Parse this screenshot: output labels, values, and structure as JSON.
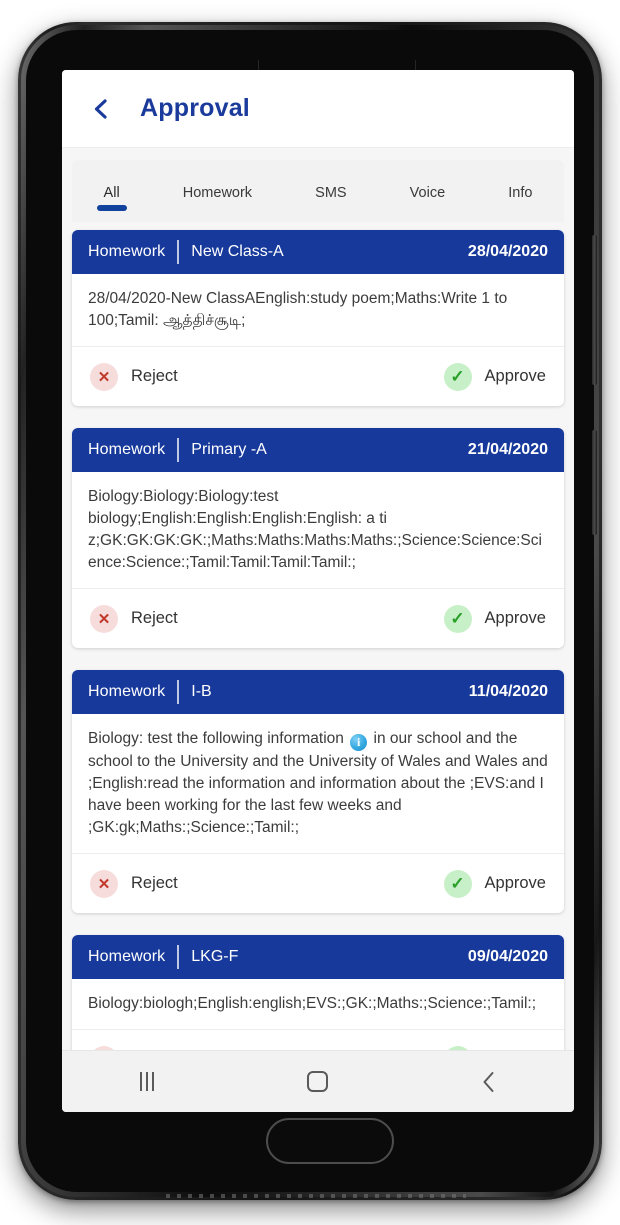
{
  "header": {
    "back_icon": "chevron-left-icon",
    "title": "Approval",
    "title_color": "#1a3a9c"
  },
  "tabs": {
    "active_index": 0,
    "items": [
      {
        "label": "All"
      },
      {
        "label": "Homework"
      },
      {
        "label": "SMS"
      },
      {
        "label": "Voice"
      },
      {
        "label": "Info"
      }
    ]
  },
  "actions": {
    "reject_label": "Reject",
    "approve_label": "Approve",
    "reject_icon": "close-x-icon",
    "approve_icon": "check-icon",
    "reject_glyph": "✕",
    "approve_glyph": "✓",
    "reject_bg": "#f7dcdc",
    "reject_fg": "#c0392b",
    "approve_bg": "#c8f0c8",
    "approve_fg": "#2aa02a"
  },
  "cards": [
    {
      "type": "Homework",
      "class": "New Class-A",
      "date": "28/04/2020",
      "body_before": "28/04/2020-New ClassAEnglish:study poem;Maths:Write 1 to 100;Tamil: ஆத்திச்சூடி;",
      "body_after": "",
      "has_info_emoji": false,
      "has_actions": true
    },
    {
      "type": "Homework",
      "class": "Primary -A",
      "date": "21/04/2020",
      "body_before": "Biology:Biology:Biology:test biology;English:English:English:English: a ti z;GK:GK:GK:GK:;Maths:Maths:Maths:Maths:;Science:Science:Science:Science:;Tamil:Tamil:Tamil:Tamil:;",
      "body_after": "",
      "has_info_emoji": false,
      "has_actions": true
    },
    {
      "type": "Homework",
      "class": "I-B",
      "date": "11/04/2020",
      "body_before": "Biology: test the following information ",
      "body_after": " in our school and the school to the University and the University of Wales and Wales and ;English:read the information and information about the ;EVS:and I have been working for the last few weeks and ;GK:gk;Maths:;Science:;Tamil:;",
      "has_info_emoji": true,
      "has_actions": true
    },
    {
      "type": "Homework",
      "class": "LKG-F",
      "date": "09/04/2020",
      "body_before": "Biology:biologh;English:english;EVS:;GK:;Maths:;Science:;Tamil:;",
      "body_after": "",
      "has_info_emoji": false,
      "has_actions": false
    }
  ],
  "card_header_color": "#17399b",
  "nav_bar": {
    "recents_label": "recent-apps",
    "home_label": "home",
    "back_label": "back"
  }
}
